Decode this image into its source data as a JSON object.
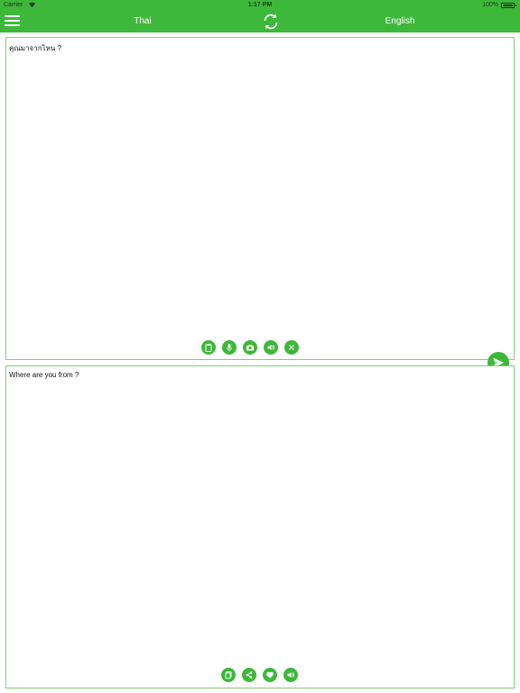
{
  "status_bar": {
    "carrier": "Carrier",
    "time": "1:17 PM",
    "battery": "100%"
  },
  "nav": {
    "source_language": "Thai",
    "target_language": "English"
  },
  "input_panel": {
    "text": "คุณมาจากไหน ?"
  },
  "output_panel": {
    "text": "Where are you from ?"
  },
  "colors": {
    "accent": "#3db83a",
    "panel_border": "#7fcf7a"
  }
}
